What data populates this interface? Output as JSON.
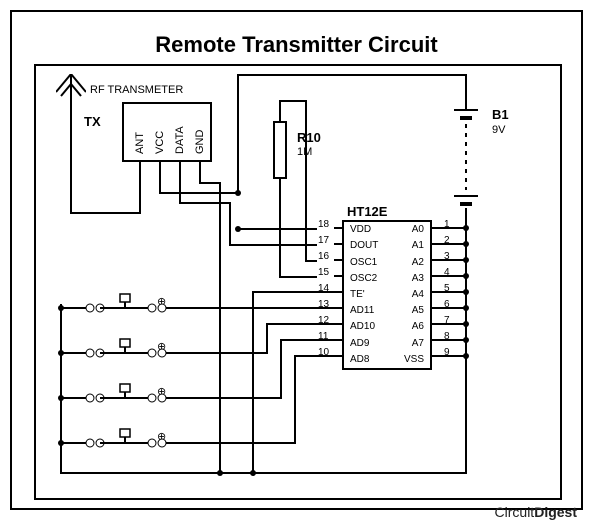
{
  "title": "Remote Transmitter Circuit",
  "rf_label": "RF TRANSMETER",
  "tx_label": "TX",
  "tx_pins": {
    "ant": "ANT",
    "vcc": "VCC",
    "data": "DATA",
    "gnd": "GND"
  },
  "resistor": {
    "name": "R10",
    "value": "1M"
  },
  "encoder": {
    "name": "HT12E",
    "left_pins": [
      {
        "num": "18",
        "name": "VDD"
      },
      {
        "num": "17",
        "name": "DOUT"
      },
      {
        "num": "16",
        "name": "OSC1"
      },
      {
        "num": "15",
        "name": "OSC2"
      },
      {
        "num": "14",
        "name": "TE'"
      },
      {
        "num": "13",
        "name": "AD11"
      },
      {
        "num": "12",
        "name": "AD10"
      },
      {
        "num": "11",
        "name": "AD9"
      },
      {
        "num": "10",
        "name": "AD8"
      }
    ],
    "right_pins": [
      {
        "num": "1",
        "name": "A0"
      },
      {
        "num": "2",
        "name": "A1"
      },
      {
        "num": "3",
        "name": "A2"
      },
      {
        "num": "4",
        "name": "A3"
      },
      {
        "num": "5",
        "name": "A4"
      },
      {
        "num": "6",
        "name": "A5"
      },
      {
        "num": "7",
        "name": "A6"
      },
      {
        "num": "8",
        "name": "A7"
      },
      {
        "num": "9",
        "name": "VSS"
      }
    ]
  },
  "battery": {
    "name": "B1",
    "value": "9V"
  },
  "switches": {
    "s1": "⊕",
    "s2": "⊕",
    "s3": "⊕",
    "s4": "⊕"
  },
  "watermark": {
    "a": "Circuit",
    "b": "Digest"
  }
}
